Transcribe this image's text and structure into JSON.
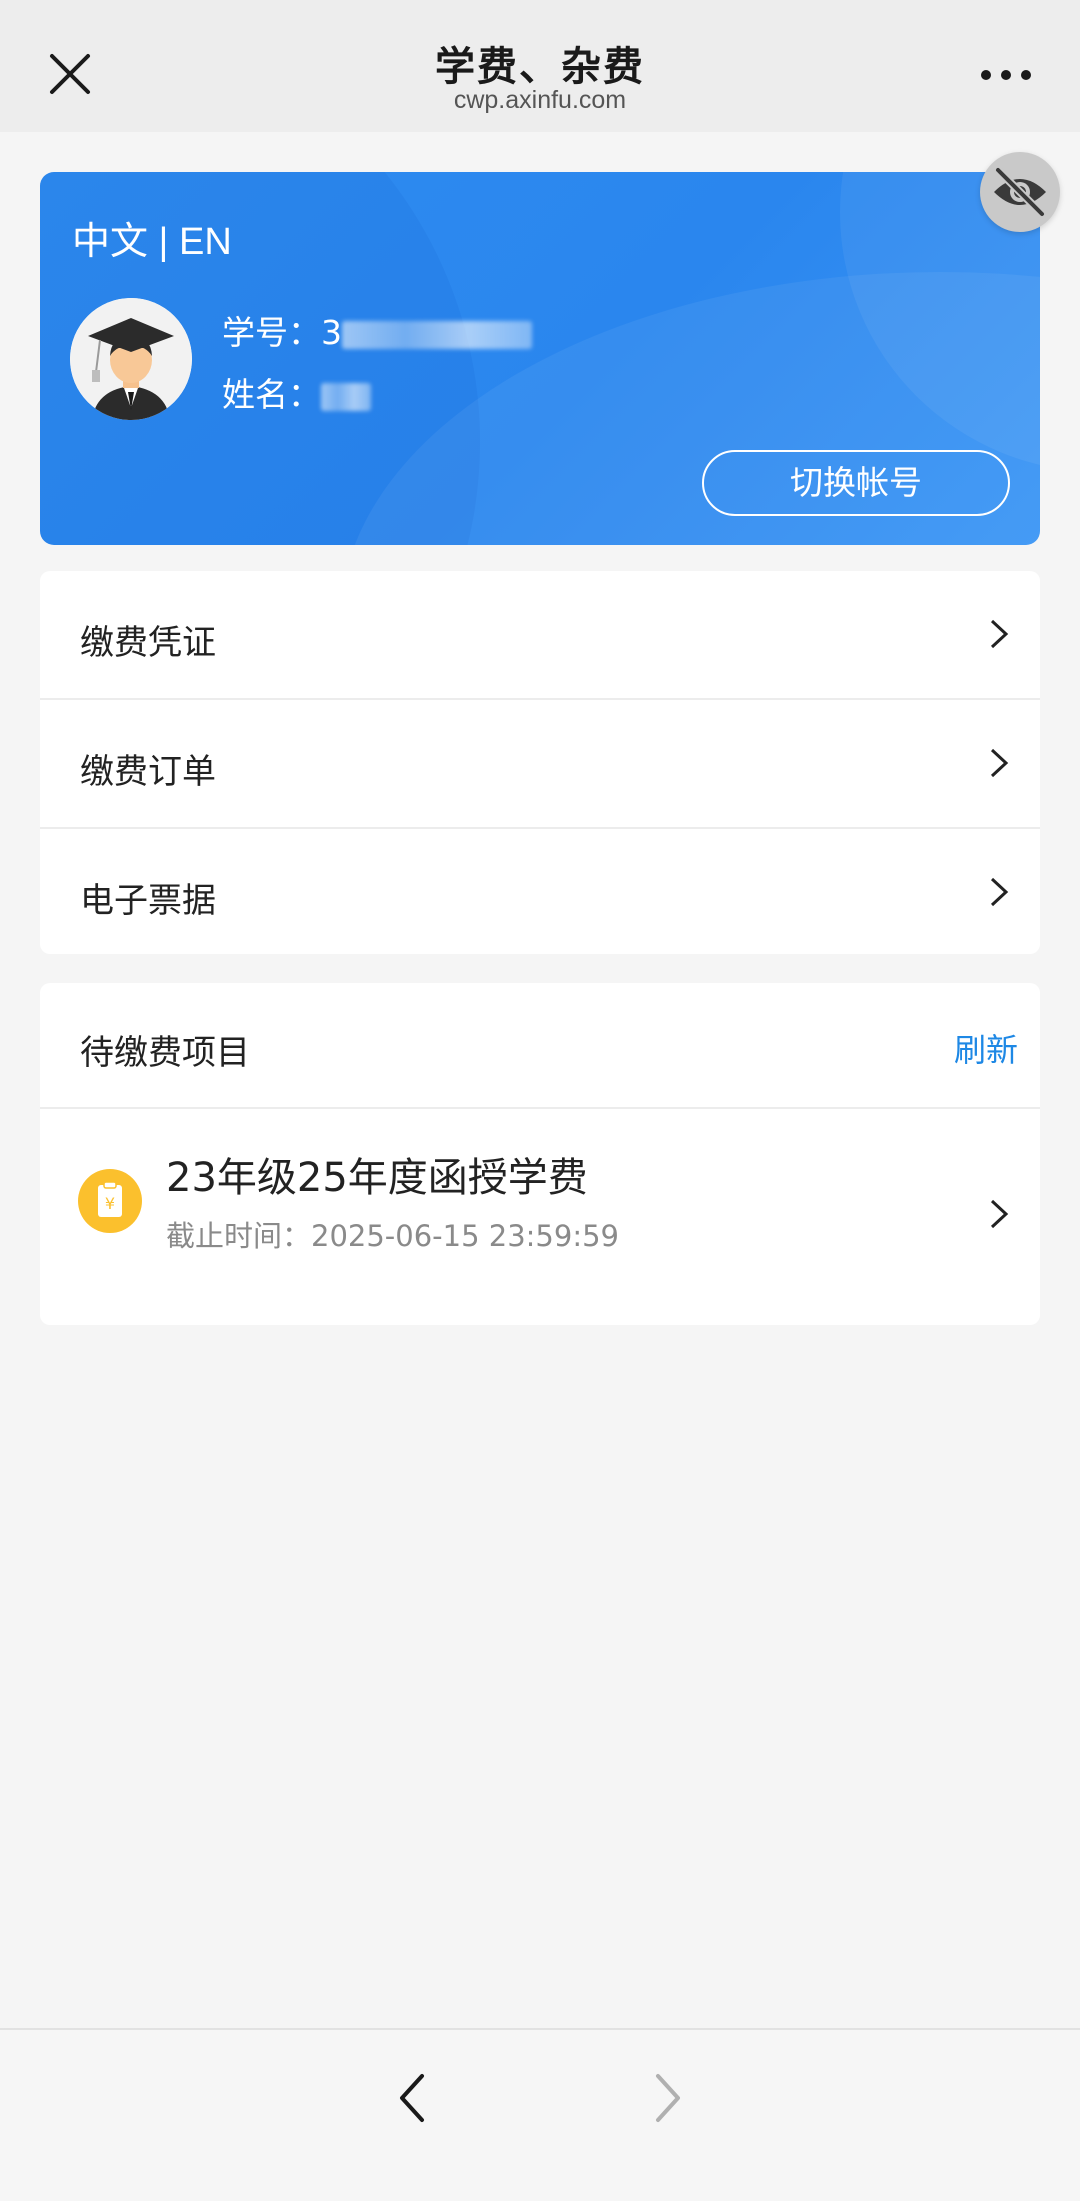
{
  "topbar": {
    "title": "学费、杂费",
    "subtitle": "cwp.axinfu.com",
    "close_icon": "close-icon",
    "more_icon": "more-icon"
  },
  "profile": {
    "lang_switch": "中文 | EN",
    "student_id_label": "学号：",
    "student_id_value": "3",
    "name_label": "姓名：",
    "switch_account_label": "切换帐号",
    "accent_color": "#2f8cf0"
  },
  "menu": {
    "items": [
      {
        "label": "缴费凭证"
      },
      {
        "label": "缴费订单"
      },
      {
        "label": "电子票据"
      }
    ]
  },
  "pending": {
    "title": "待缴费项目",
    "refresh_label": "刷新",
    "refresh_color": "#1e88e5",
    "items": [
      {
        "name": "23年级25年度函授学费",
        "deadline": "截止时间：2025-06-15 23:59:59",
        "icon": "bill-icon",
        "icon_color": "#fbc02d"
      }
    ]
  },
  "bottom_nav": {
    "back_icon": "back-arrow-icon",
    "forward_icon": "forward-arrow-icon"
  }
}
